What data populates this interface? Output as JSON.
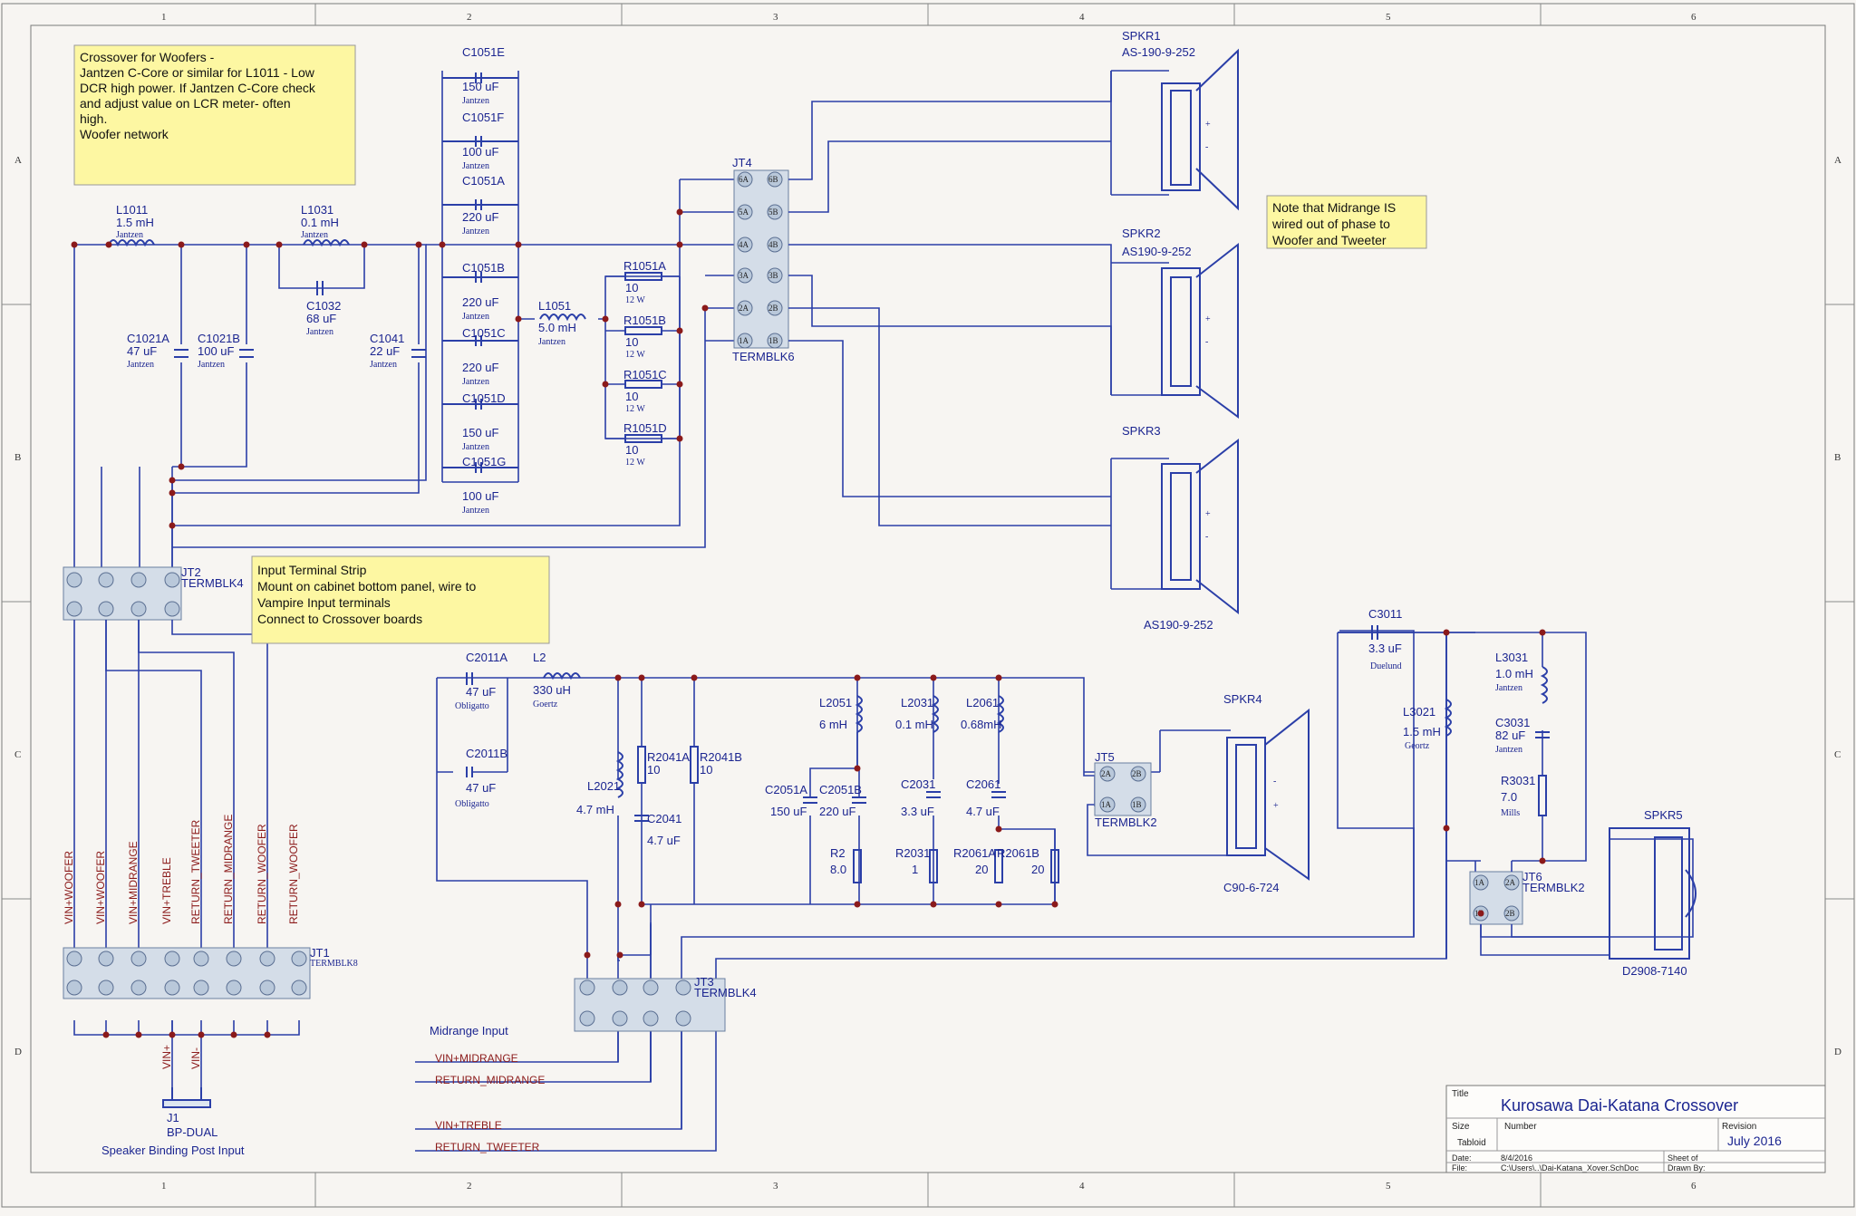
{
  "zones": {
    "cols": [
      "1",
      "2",
      "3",
      "4",
      "5",
      "6"
    ],
    "rows": [
      "A",
      "B",
      "C",
      "D"
    ]
  },
  "notes": {
    "woofer": [
      "Crossover for Woofers -",
      "Jantzen C-Core or similar for L1011 - Low",
      "DCR high power. If Jantzen C-Core check",
      "and adjust value on LCR meter- often",
      "high.",
      "Woofer network"
    ],
    "midrange_phase": [
      "Note that Midrange IS",
      "wired out of phase to",
      "Woofer and Tweeter"
    ],
    "input_strip": [
      "Input Terminal Strip",
      "Mount on cabinet bottom panel, wire to",
      "Vampire Input terminals",
      "Connect to Crossover boards"
    ]
  },
  "components": {
    "L1011": [
      "L1011",
      "1.5 mH",
      "Jantzen"
    ],
    "L1031": [
      "L1031",
      "0.1 mH",
      "Jantzen"
    ],
    "C1032": [
      "C1032",
      "68 uF",
      "Jantzen"
    ],
    "C1021A": [
      "C1021A",
      "47 uF",
      "Jantzen"
    ],
    "C1021B": [
      "C1021B",
      "100 uF",
      "Jantzen"
    ],
    "C1041": [
      "C1041",
      "22 uF",
      "Jantzen"
    ],
    "C1051E": [
      "C1051E",
      "150 uF",
      "Jantzen"
    ],
    "C1051F": [
      "C1051F",
      "100 uF",
      "Jantzen"
    ],
    "C1051A": [
      "C1051A",
      "220 uF",
      "Jantzen"
    ],
    "C1051B": [
      "C1051B",
      "220 uF",
      "Jantzen"
    ],
    "C1051C": [
      "C1051C",
      "220 uF",
      "Jantzen"
    ],
    "C1051D": [
      "C1051D",
      "150 uF",
      "Jantzen"
    ],
    "C1051G": [
      "C1051G",
      "100 uF",
      "Jantzen"
    ],
    "L1051": [
      "L1051",
      "5.0 mH",
      "Jantzen"
    ],
    "R1051A": [
      "R1051A",
      "10",
      "12 W"
    ],
    "R1051B": [
      "R1051B",
      "10",
      "12 W"
    ],
    "R1051C": [
      "R1051C",
      "10",
      "12 W"
    ],
    "R1051D": [
      "R1051D",
      "10",
      "12 W"
    ],
    "C2011A": [
      "C2011A",
      "47 uF",
      "Obligatto"
    ],
    "C2011B": [
      "C2011B",
      "47 uF",
      "Obligatto"
    ],
    "L2": [
      "L2",
      "330 uH",
      "Goertz"
    ],
    "L2021": [
      "L2021",
      "4.7 mH"
    ],
    "R2041A": [
      "R2041A",
      "10"
    ],
    "R2041B": [
      "R2041B",
      "10"
    ],
    "C2041": [
      "C2041",
      "4.7 uF"
    ],
    "L2051": [
      "L2051",
      "6 mH"
    ],
    "C2051A": [
      "C2051A",
      "150 uF"
    ],
    "C2051B": [
      "C2051B",
      "220 uF"
    ],
    "R2": [
      "R2",
      "8.0"
    ],
    "L2031": [
      "L2031",
      "0.1 mH"
    ],
    "C2031": [
      "C2031",
      "3.3 uF"
    ],
    "R2031": [
      "R2031",
      "1"
    ],
    "L2061": [
      "L2061",
      "0.68mH"
    ],
    "C2061": [
      "C2061",
      "4.7 uF"
    ],
    "R2061A": [
      "R2061A",
      "20"
    ],
    "R2061B": [
      "R2061B",
      "20"
    ],
    "C3011": [
      "C3011",
      "3.3  uF",
      "Duelund"
    ],
    "L3021": [
      "L3021",
      "1.5 mH",
      "Geortz"
    ],
    "L3031": [
      "L3031",
      "1.0 mH",
      "Jantzen"
    ],
    "C3031": [
      "C3031",
      "82 uF",
      "Jantzen"
    ],
    "R3031": [
      "R3031",
      "7.0",
      "Mills"
    ]
  },
  "speakers": {
    "SPKR1": [
      "SPKR1",
      "AS-190-9-252"
    ],
    "SPKR2": [
      "SPKR2",
      "AS190-9-252"
    ],
    "SPKR3": [
      "SPKR3",
      "AS190-9-252"
    ],
    "SPKR4": [
      "SPKR4",
      "C90-6-724"
    ],
    "SPKR5": [
      "SPKR5",
      "D2908-7140"
    ]
  },
  "terminals": {
    "JT4": [
      "JT4",
      "TERMBLK6"
    ],
    "JT2": [
      "JT2",
      "TERMBLK4"
    ],
    "JT1": [
      "JT1",
      "TERMBLK8"
    ],
    "JT3": [
      "JT3",
      "TERMBLK4"
    ],
    "JT5": [
      "JT5",
      "TERMBLK2"
    ],
    "JT6": [
      "JT6",
      "TERMBLK2"
    ],
    "J1": [
      "J1",
      "BP-DUAL",
      "Speaker Binding Post Input"
    ]
  },
  "nets": {
    "jt1": [
      "VIN+WOOFER",
      "VIN+WOOFER",
      "VIN+MIDRANGE",
      "VIN+TREBLE",
      "RETURN_TWEETER",
      "RETURN_MIDRANGE",
      "RETURN_WOOFER",
      "RETURN_WOOFER"
    ],
    "vin_plus": "VIN+",
    "vin_minus": "VIN-",
    "midrange_input_title": "Midrange Input",
    "mid_inputs": [
      "VIN+MIDRANGE",
      "RETURN_MIDRANGE",
      "VIN+TREBLE",
      "RETURN_TWEETER"
    ]
  },
  "title_block": {
    "title_label": "Title",
    "title": "Kurosawa Dai-Katana Crossover",
    "size_label": "Size",
    "size": "Tabloid",
    "number_label": "Number",
    "revision_label": "Revision",
    "revision": "July 2016",
    "date_label": "Date:",
    "date": "8/4/2016",
    "sheet_label": "Sheet    of",
    "file_label": "File:",
    "file": "C:\\Users\\..\\Dai-Katana_Xover.SchDoc",
    "drawn_label": "Drawn By:"
  }
}
